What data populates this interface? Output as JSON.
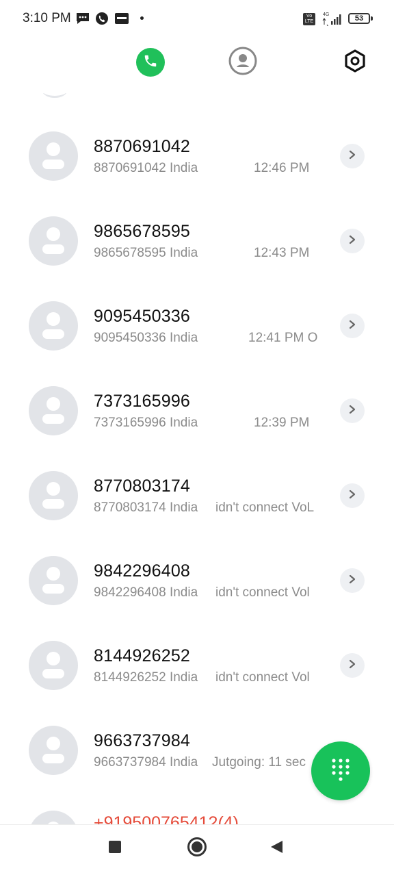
{
  "status_bar": {
    "time": "3:10 PM",
    "icons": [
      "message-icon",
      "whatsapp-call-icon",
      "paytm-icon"
    ],
    "network_label": "4G",
    "volte_label": "Vo LTE",
    "battery": "53"
  },
  "top_tabs": [
    {
      "name": "phone-tab",
      "icon": "phone-icon",
      "active": true
    },
    {
      "name": "contacts-tab",
      "icon": "person-icon",
      "active": false
    },
    {
      "name": "settings-tab",
      "icon": "hexagon-settings-icon",
      "active": false
    }
  ],
  "call_log": [
    {
      "number": "8870691042",
      "detail": "8870691042 India",
      "extra": "12:46 PM"
    },
    {
      "number": "9865678595",
      "detail": "9865678595 India",
      "extra": "12:43 PM"
    },
    {
      "number": "9095450336",
      "detail": "9095450336 India",
      "extra": "12:41 PM O"
    },
    {
      "number": "7373165996",
      "detail": "7373165996 India",
      "extra": "12:39 PM"
    },
    {
      "number": "8770803174",
      "detail": "8770803174 India",
      "extra": "idn't connect VoL"
    },
    {
      "number": "9842296408",
      "detail": "9842296408 India",
      "extra": "idn't connect Vol"
    },
    {
      "number": "8144926252",
      "detail": "8144926252 India",
      "extra": "idn't connect Vol"
    },
    {
      "number": "9663737984",
      "detail": "9663737984 India",
      "extra": "Jutgoing: 11 sec"
    }
  ],
  "partial_entry": "+919500765412(4)",
  "colors": {
    "accent_green": "#20c05a",
    "missed_red": "#e54b3a"
  },
  "fab": {
    "icon": "dialpad-icon"
  },
  "nav": [
    "recents-square-icon",
    "home-circle-icon",
    "back-triangle-icon"
  ]
}
